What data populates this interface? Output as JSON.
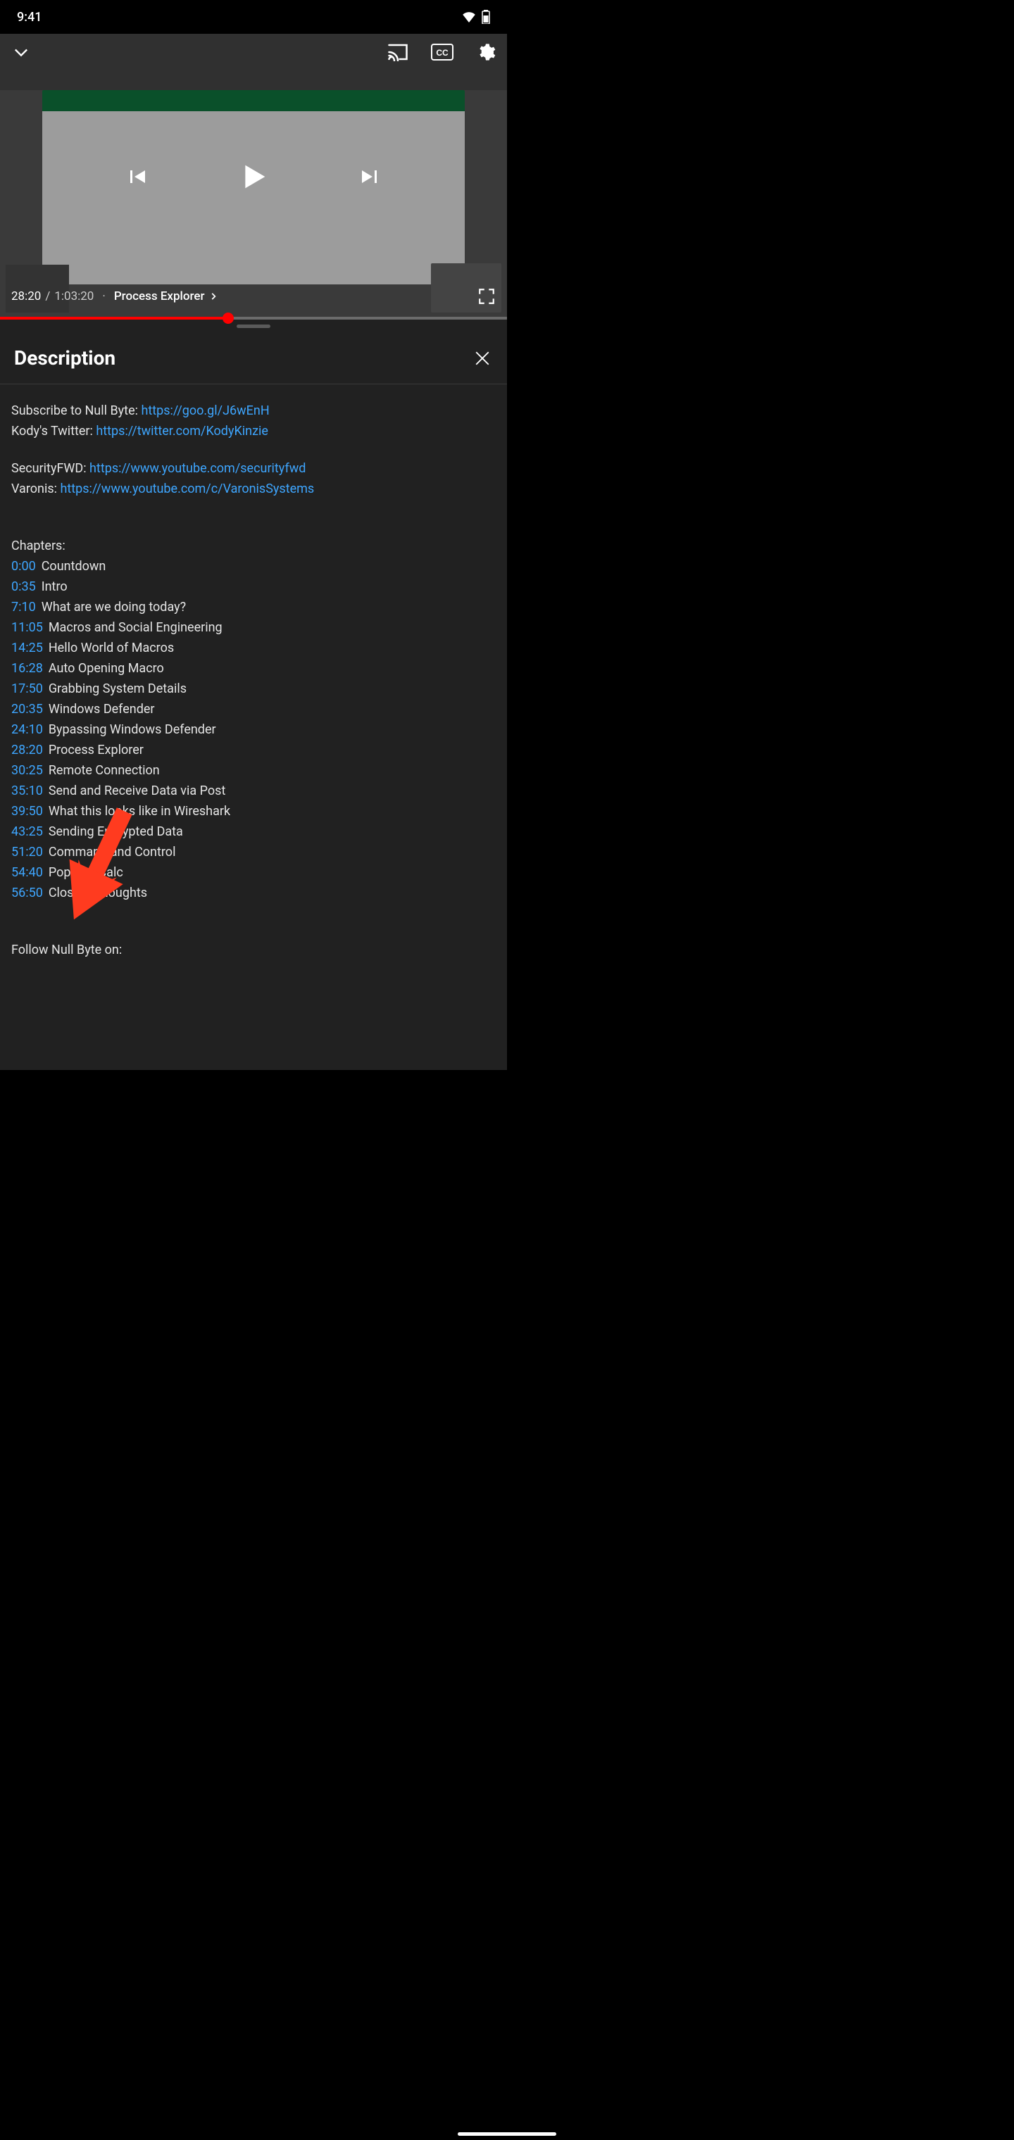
{
  "status": {
    "time": "9:41"
  },
  "player": {
    "current_time": "28:20",
    "total_time": "1:03:20",
    "sep": "/",
    "dot": "·",
    "chapter_label": "Process Explorer",
    "progress_pct": 45
  },
  "panel": {
    "title": "Description"
  },
  "description": {
    "subscribe_label": "Subscribe to Null Byte: ",
    "subscribe_url": "https://goo.gl/J6wEnH",
    "kody_label": "Kody's Twitter: ",
    "kody_url": "https://twitter.com/KodyKinzie",
    "securityfwd_label": "SecurityFWD: ",
    "securityfwd_url": "https://www.youtube.com/securityfwd",
    "varonis_label": "Varonis: ",
    "varonis_url": "https://www.youtube.com/c/VaronisSystems",
    "chapters_heading": "Chapters:",
    "follow_heading": "Follow Null Byte on:"
  },
  "chapters": [
    {
      "time": "0:00",
      "title": "Countdown"
    },
    {
      "time": "0:35",
      "title": "Intro"
    },
    {
      "time": "7:10",
      "title": "What are we doing today?"
    },
    {
      "time": "11:05",
      "title": "Macros and Social Engineering"
    },
    {
      "time": "14:25",
      "title": "Hello World of Macros"
    },
    {
      "time": "16:28",
      "title": "Auto Opening Macro"
    },
    {
      "time": "17:50",
      "title": "Grabbing System Details"
    },
    {
      "time": "20:35",
      "title": "Windows Defender"
    },
    {
      "time": "24:10",
      "title": "Bypassing Windows Defender"
    },
    {
      "time": "28:20",
      "title": "Process Explorer"
    },
    {
      "time": "30:25",
      "title": "Remote Connection"
    },
    {
      "time": "35:10",
      "title": "Send and Receive Data via Post"
    },
    {
      "time": "39:50",
      "title": "What this looks like in Wireshark"
    },
    {
      "time": "43:25",
      "title": "Sending Encrypted Data"
    },
    {
      "time": "51:20",
      "title": "Command and Control"
    },
    {
      "time": "54:40",
      "title": "Popping Calc"
    },
    {
      "time": "56:50",
      "title": "Closing Thoughts"
    }
  ],
  "colors": {
    "link": "#3ea6ff",
    "accent": "#ff0000",
    "panel_bg": "#212121"
  }
}
